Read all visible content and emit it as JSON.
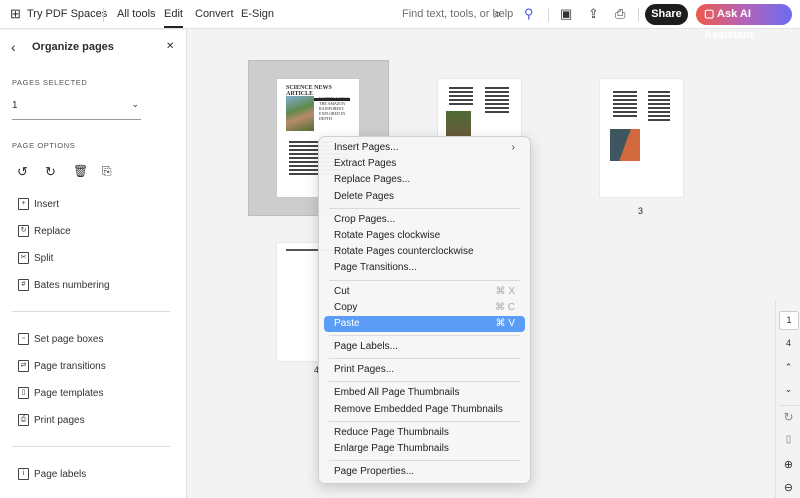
{
  "topbar": {
    "spaces": "Try PDF Spaces",
    "tabs": [
      "All tools",
      "Edit",
      "Convert",
      "E-Sign"
    ],
    "active_tab": "Edit",
    "search_placeholder": "Find text, tools, or help",
    "share": "Share",
    "ai": "Ask AI Assistant"
  },
  "sidebar": {
    "title": "Organize pages",
    "pages_selected_label": "PAGES SELECTED",
    "pages_selected_value": "1",
    "page_options_label": "PAGE OPTIONS",
    "items1": [
      "Insert",
      "Replace",
      "Split",
      "Bates numbering"
    ],
    "items2": [
      "Set page boxes",
      "Page transitions",
      "Page templates",
      "Print pages"
    ],
    "items3": [
      "Page labels"
    ]
  },
  "thumbs": {
    "article_title": "SCIENCE NEWS ARTICLE",
    "headline": "EARTH'S LUNGS: THE AMAZON RAINFOREST, EXPLORED IN DEPTH",
    "labels": [
      "3",
      "4"
    ]
  },
  "menu": {
    "groups": [
      [
        "Insert Pages...",
        "Extract Pages",
        "Replace Pages...",
        "Delete Pages"
      ],
      [
        "Crop Pages...",
        "Rotate Pages clockwise",
        "Rotate Pages counterclockwise",
        "Page Transitions..."
      ],
      [
        "Cut",
        "Copy",
        "Paste"
      ],
      [
        "Page Labels..."
      ],
      [
        "Print Pages..."
      ],
      [
        "Embed All Page Thumbnails",
        "Remove Embedded Page Thumbnails"
      ],
      [
        "Reduce Page Thumbnails",
        "Enlarge Page Thumbnails"
      ],
      [
        "Page Properties..."
      ]
    ],
    "shortcuts": {
      "cut": "⌘ X",
      "copy": "⌘ C",
      "paste": "⌘ V"
    },
    "highlighted": "Paste"
  },
  "rail": {
    "current_page": "1",
    "total_pages": "4"
  }
}
